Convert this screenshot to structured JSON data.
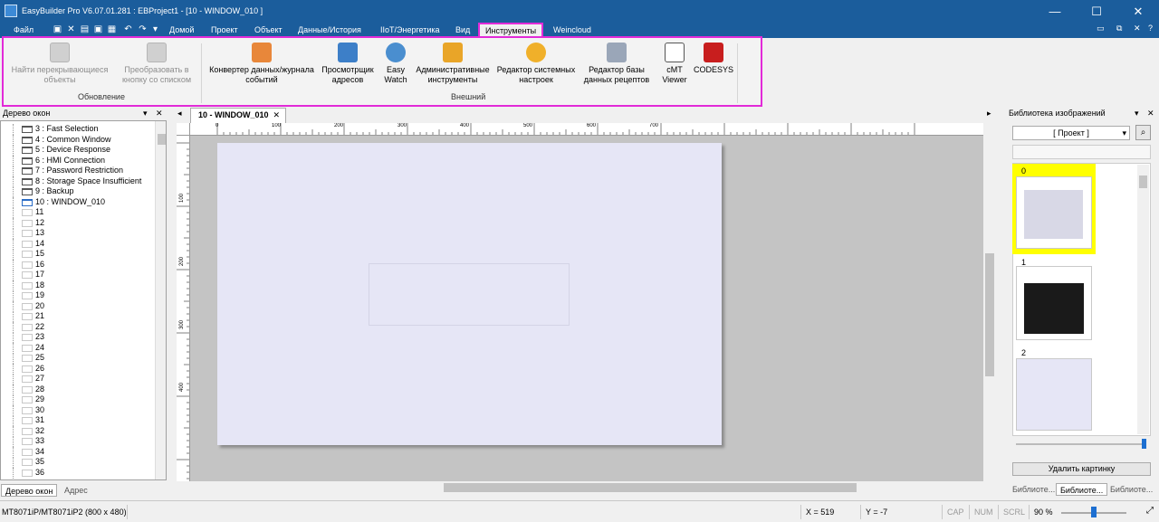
{
  "window": {
    "title": "EasyBuilder Pro V6.07.01.281 : EBProject1 - [10 - WINDOW_010 ]",
    "minimize": "—",
    "maximize": "☐",
    "close": "✕"
  },
  "menu": {
    "file": "Файл",
    "tabs": [
      "Домой",
      "Проект",
      "Объект",
      "Данные/История",
      "IIoT/Энергетика",
      "Вид",
      "Инструменты",
      "Weincloud"
    ],
    "active_tab": "Инструменты"
  },
  "ribbon": {
    "group_update": {
      "label": "Обновление",
      "buttons": [
        "Найти перекрывающиеся объекты",
        "Преобразовать в кнопку со списком"
      ]
    },
    "group_external": {
      "label": "Внешний",
      "buttons": [
        "Конвертер данных/журнала событий",
        "Просмотрщик адресов",
        "Easy Watch",
        "Административные инструменты",
        "Редактор системных настроек",
        "Редактор базы данных рецептов",
        "cMT Viewer",
        "CODESYS"
      ]
    }
  },
  "left_panel": {
    "title": "Дерево окон",
    "items": [
      "3 : Fast Selection",
      "4 : Common Window",
      "5 : Device Response",
      "6 : HMI Connection",
      "7 : Password Restriction",
      "8 : Storage Space Insufficient",
      "9 : Backup",
      "10 : WINDOW_010",
      "11",
      "12",
      "13",
      "14",
      "15",
      "16",
      "17",
      "18",
      "19",
      "20",
      "21",
      "22",
      "23",
      "24",
      "25",
      "26",
      "27",
      "28",
      "29",
      "30",
      "31",
      "32",
      "33",
      "34",
      "35",
      "36"
    ],
    "tabs": [
      "Дерево окон",
      "Адрес"
    ]
  },
  "document": {
    "tab": "10 - WINDOW_010",
    "ruler_top": [
      "0",
      "100",
      "200",
      "300",
      "400",
      "500",
      "600",
      "700"
    ],
    "ruler_left": [
      "100",
      "200",
      "300",
      "400"
    ]
  },
  "right_panel": {
    "title": "Библиотека изображений",
    "dropdown": "[ Проект ]",
    "thumb_labels": [
      "0",
      "1",
      "2"
    ],
    "delete_button": "Удалить картинку",
    "tabs": [
      "Библиоте...",
      "Библиоте...",
      "Библиоте..."
    ]
  },
  "status": {
    "model": "MT8071iP/MT8071iP2 (800 x 480)",
    "x": "X = 519",
    "y": "Y = -7",
    "cap": "CAP",
    "num": "NUM",
    "scrl": "SCRL",
    "zoom": "90 %"
  },
  "colors": {
    "accent": "#1b5d9c",
    "highlight": "#e22ad8",
    "page": "#e6e6f6",
    "selected_thumb": "#ffff00"
  }
}
